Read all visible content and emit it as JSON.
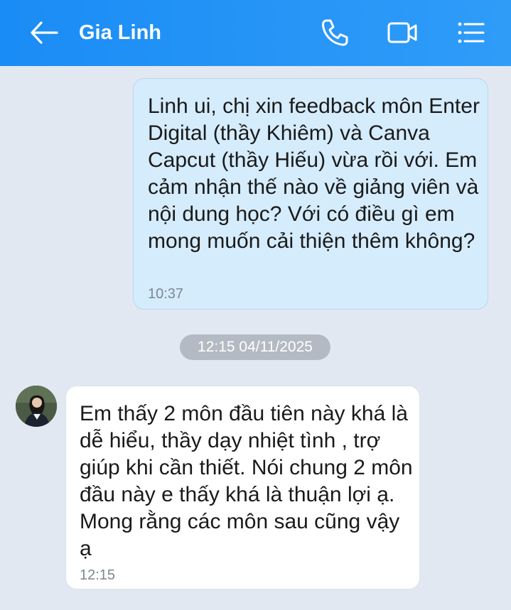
{
  "header": {
    "title": "Gia Linh",
    "icons": [
      "back-arrow-icon",
      "phone-icon",
      "video-icon",
      "list-menu-icon"
    ]
  },
  "messages": [
    {
      "direction": "outgoing",
      "text": "Linh ui, chị xin feedback môn Enter Digital (thầy Khiêm) và Canva Capcut (thầy Hiếu) vừa rồi với. Em cảm nhận thế nào về giảng viên và nội dung học? Với có điều gì em mong muốn cải thiện thêm không?",
      "time": "10:37"
    },
    {
      "direction": "incoming",
      "text": "Em thấy 2 môn đầu tiên này khá là dễ hiểu, thầy dạy nhiệt tình , trợ giúp khi cần thiết. Nói chung 2 môn đầu này e thấy khá là thuận lợi ạ. Mong rằng các môn sau cũng vậy ạ",
      "time": "12:15"
    }
  ],
  "date_divider": "12:15 04/11/2025",
  "colors": {
    "header_start": "#1a8cf5",
    "header_end": "#2f9cf8",
    "background": "#e2e8f1",
    "outgoing_bubble": "#d5ecfd",
    "incoming_bubble": "#ffffff",
    "timestamp": "#7c8794",
    "date_pill": "#b4bac3"
  }
}
